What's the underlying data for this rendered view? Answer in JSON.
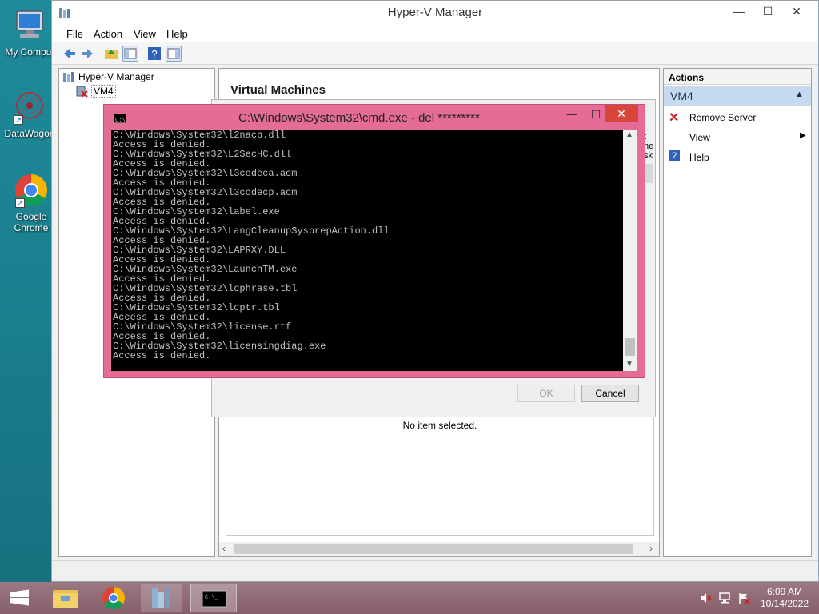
{
  "desktop": {
    "icons": [
      {
        "label": "My Comput",
        "icon": "computer-icon"
      },
      {
        "label": "DataWagon",
        "icon": "datawagon-icon"
      },
      {
        "label": "Google Chrome",
        "line1": "Google",
        "line2": "Chrome",
        "icon": "chrome-icon"
      }
    ]
  },
  "window": {
    "title": "Hyper-V Manager",
    "menu": [
      "File",
      "Action",
      "View",
      "Help"
    ],
    "tree": {
      "root": "Hyper-V Manager",
      "child": "VM4"
    },
    "center": {
      "header": "Virtual Machines",
      "no_selection": "No item selected."
    },
    "actions": {
      "header": "Actions",
      "group": "VM4",
      "items": [
        {
          "label": "Remove Server",
          "icon": "remove-x-icon"
        },
        {
          "label": "View",
          "icon": "chevron-right-icon"
        },
        {
          "label": "Help",
          "icon": "help-icon"
        }
      ]
    }
  },
  "dialog": {
    "ok_label": "OK",
    "cancel_label": "Cancel",
    "partial_right_text": [
      "t",
      "ne",
      "sk"
    ]
  },
  "cmd": {
    "title": "C:\\Windows\\System32\\cmd.exe - del  *********",
    "lines": [
      "C:\\Windows\\System32\\l2nacp.dll",
      "Access is denied.",
      "C:\\Windows\\System32\\L2SecHC.dll",
      "Access is denied.",
      "C:\\Windows\\System32\\l3codeca.acm",
      "Access is denied.",
      "C:\\Windows\\System32\\l3codecp.acm",
      "Access is denied.",
      "C:\\Windows\\System32\\label.exe",
      "Access is denied.",
      "C:\\Windows\\System32\\LangCleanupSysprepAction.dll",
      "Access is denied.",
      "C:\\Windows\\System32\\LAPRXY.DLL",
      "Access is denied.",
      "C:\\Windows\\System32\\LaunchTM.exe",
      "Access is denied.",
      "C:\\Windows\\System32\\lcphrase.tbl",
      "Access is denied.",
      "C:\\Windows\\System32\\lcptr.tbl",
      "Access is denied.",
      "C:\\Windows\\System32\\license.rtf",
      "Access is denied.",
      "C:\\Windows\\System32\\licensingdiag.exe",
      "Access is denied."
    ]
  },
  "taskbar": {
    "time": "6:09 AM",
    "date": "10/14/2022"
  },
  "colors": {
    "cmd_frame": "#e46c96",
    "desktop": "#1a7f8e",
    "actions_group": "#c7d9ee",
    "taskbar": "#8a6a73"
  }
}
